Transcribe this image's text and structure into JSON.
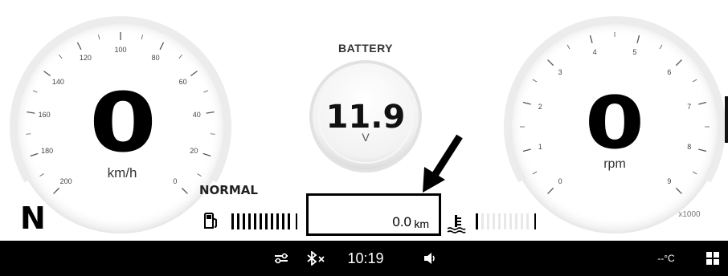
{
  "gear": "N",
  "speedometer": {
    "value": "0",
    "unit": "km/h",
    "ticks": [
      "0",
      "20",
      "40",
      "60",
      "80",
      "100",
      "120",
      "140",
      "160",
      "180",
      "200"
    ]
  },
  "battery": {
    "title": "BATTERY",
    "value": "11.9",
    "unit": "V"
  },
  "tachometer": {
    "value": "0",
    "unit": "rpm",
    "ticks": [
      "0",
      "1",
      "2",
      "3",
      "4",
      "5",
      "6",
      "7",
      "8",
      "9"
    ],
    "multiplier": "x1000"
  },
  "drive_mode": "NORMAL",
  "fuel": {
    "icon": "fuel-pump-icon",
    "level_fraction": 1.0
  },
  "trip": {
    "value": "0.0",
    "unit": "km"
  },
  "coolant": {
    "icon": "coolant-temp-icon",
    "level_fraction": 0.1
  },
  "statusbar": {
    "time": "10:19",
    "temperature": "--°C",
    "icons": [
      "connection-icon",
      "bluetooth-off-icon",
      "volume-icon",
      "apps-grid-icon"
    ]
  },
  "colors": {
    "background": "#ffffff",
    "statusbar": "#000000",
    "digits": "#000000"
  }
}
